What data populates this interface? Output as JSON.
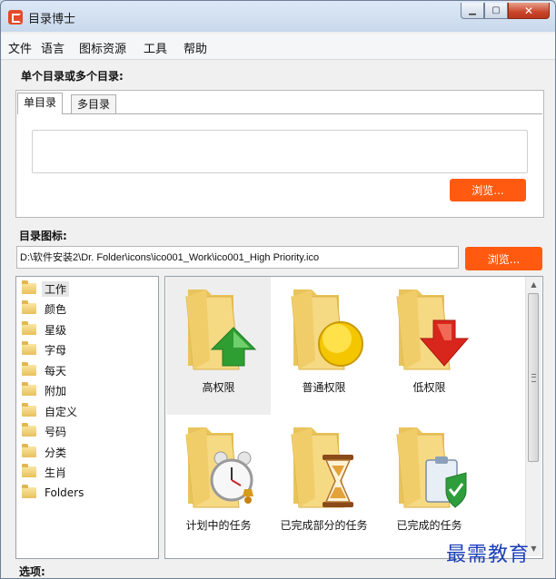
{
  "window": {
    "title": "目录博士",
    "minimize_glyph": "▁",
    "maximize_glyph": "▢",
    "close_glyph": "✕"
  },
  "menu": [
    "文件",
    "语言",
    "图标资源",
    "工具",
    "帮助"
  ],
  "directories": {
    "section_label": "单个目录或多个目录:",
    "tabs": [
      "单目录",
      "多目录"
    ],
    "active_tab": "单目录",
    "input_value": "",
    "browse_label": "浏览..."
  },
  "icon": {
    "section_label": "目录图标:",
    "path": "D:\\软件安装2\\Dr. Folder\\icons\\ico001_Work\\ico001_High Priority.ico",
    "browse_label": "浏览..."
  },
  "categories": [
    "工作",
    "颜色",
    "星级",
    "字母",
    "每天",
    "附加",
    "自定义",
    "号码",
    "分类",
    "生肖",
    "Folders"
  ],
  "selected_category": "工作",
  "icons": [
    {
      "label": "高权限",
      "overlay": "up-arrow-icon",
      "selected": true
    },
    {
      "label": "普通权限",
      "overlay": "circle-icon",
      "selected": false
    },
    {
      "label": "低权限",
      "overlay": "down-arrow-icon",
      "selected": false
    },
    {
      "label": "计划中的任务",
      "overlay": "alarm-clock-icon",
      "selected": false
    },
    {
      "label": "已完成部分的任务",
      "overlay": "hourglass-icon",
      "selected": false
    },
    {
      "label": "已完成的任务",
      "overlay": "clipboard-check-icon",
      "selected": false
    }
  ],
  "options_label": "选项:",
  "watermark": "最需教育",
  "colors": {
    "accent_orange": "#ff5a10",
    "folder_yellow": "#f3cf6e",
    "watermark_blue": "#1a3fb8"
  }
}
